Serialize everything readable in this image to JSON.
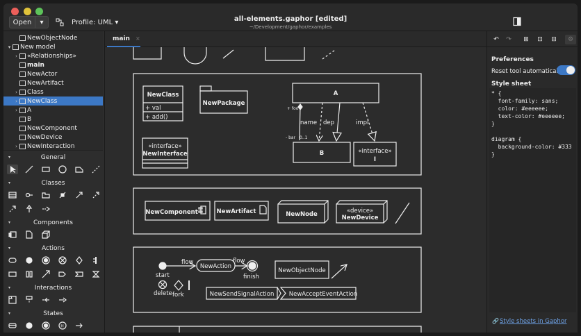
{
  "window": {
    "title": "all-elements.gaphor [edited]",
    "subtitle": "~/Development/gaphor/examples"
  },
  "header": {
    "open_label": "Open",
    "profile_label": "Profile: UML"
  },
  "tree": {
    "items": [
      {
        "label": "NewObjectNode",
        "bold": false,
        "expander": "",
        "indent": 1
      },
      {
        "label": "New model",
        "bold": false,
        "expander": "▾",
        "indent": 0
      },
      {
        "label": "«Relationships»",
        "bold": false,
        "expander": "›",
        "indent": 1
      },
      {
        "label": "main",
        "bold": true,
        "expander": "",
        "indent": 1
      },
      {
        "label": "NewActor",
        "bold": false,
        "expander": "",
        "indent": 1
      },
      {
        "label": "NewArtifact",
        "bold": false,
        "expander": "",
        "indent": 1
      },
      {
        "label": "Class",
        "bold": false,
        "expander": "›",
        "indent": 1
      },
      {
        "label": "NewClass",
        "bold": false,
        "expander": "›",
        "indent": 1
      },
      {
        "label": "A",
        "bold": false,
        "expander": "›",
        "indent": 1
      },
      {
        "label": "B",
        "bold": false,
        "expander": "",
        "indent": 1
      },
      {
        "label": "NewComponent",
        "bold": false,
        "expander": "",
        "indent": 1
      },
      {
        "label": "NewDevice",
        "bold": false,
        "expander": "",
        "indent": 1
      },
      {
        "label": "NewInteraction",
        "bold": false,
        "expander": "›",
        "indent": 1
      }
    ],
    "selected_label": "NewClass"
  },
  "toolbox": {
    "sections": [
      {
        "label": "General"
      },
      {
        "label": "Classes"
      },
      {
        "label": "Components"
      },
      {
        "label": "Actions"
      },
      {
        "label": "Interactions"
      },
      {
        "label": "States"
      }
    ]
  },
  "tabs": {
    "main_label": "main",
    "close_glyph": "×"
  },
  "diagram": {
    "class_name": "NewClass",
    "class_attr": "+ val",
    "class_op": "+ add()",
    "package_name": "NewPackage",
    "interface_stereo": "«interface»",
    "interface_name": "NewInterface",
    "class_a": "A",
    "class_b": "B",
    "interface_small_stereo": "«interface»",
    "interface_small_name": "I",
    "assoc_name": "name",
    "dep_label": "dep",
    "impl_label": "impl",
    "assoc_foo": "+ foo",
    "assoc_bar": "- bar",
    "multiplicity": "0..1",
    "component_name": "NewComponent",
    "artifact_name": "NewArtifact",
    "node_name": "NewNode",
    "device_stereo": "«device»",
    "device_name": "NewDevice",
    "start_label": "start",
    "flow1": "flow",
    "flow2": "flow",
    "action_name": "NewAction",
    "finish_label": "finish",
    "object_node": "NewObjectNode",
    "delete_label": "delete",
    "fork_label": "fork",
    "send_signal": "NewSendSignalAction",
    "accept_event": "NewAcceptEventAction"
  },
  "properties": {
    "preferences_heading": "Preferences",
    "reset_label": "Reset tool automatically",
    "reset_on": true,
    "style_heading": "Style sheet",
    "style_text": "* {\n  font-family: sans;\n  color: #eeeeee;\n  text-color: #eeeeee;\n}\n\ndiagram {\n  background-color: #333\n}",
    "link_label": "Style sheets in Gaphor"
  },
  "colors": {
    "accent": "#3c78c5",
    "close": "#ec5f5a",
    "minimize": "#e0c33a",
    "maximize": "#5dc35a"
  }
}
